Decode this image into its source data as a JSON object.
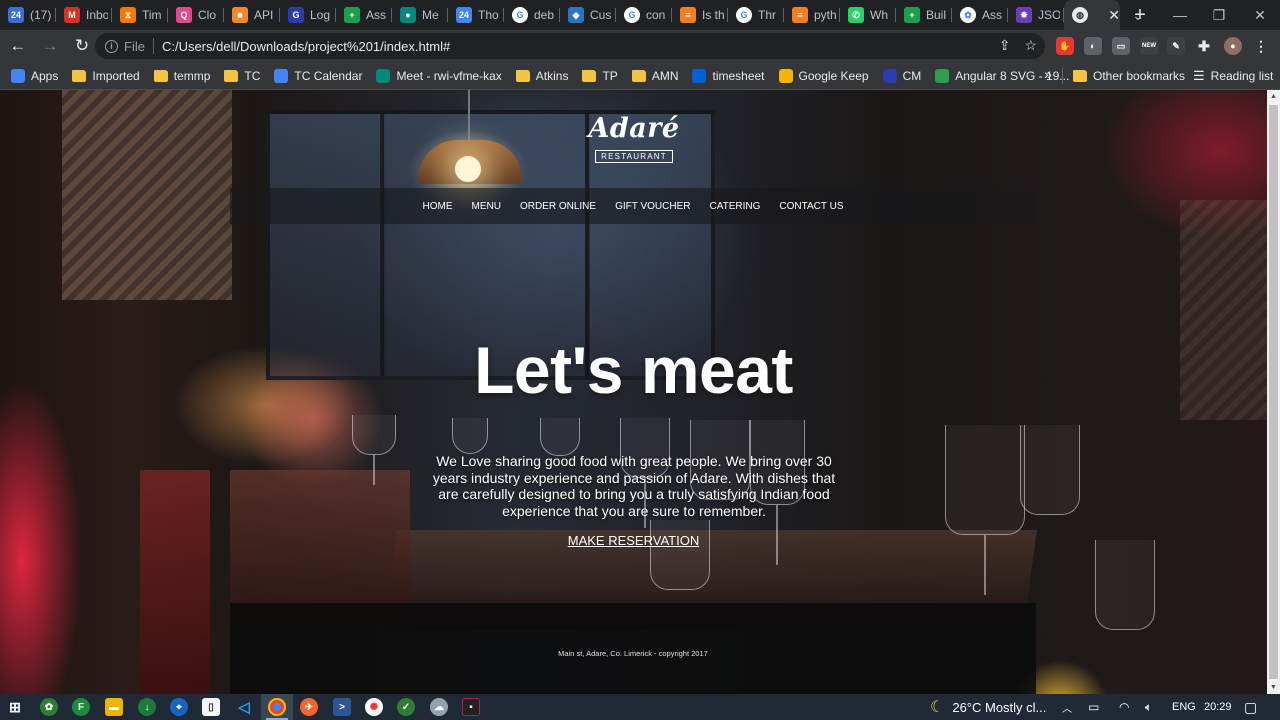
{
  "browser": {
    "tabs": [
      {
        "label": "(17)",
        "icon": "badge-24-icon",
        "color": "#3b6fd6",
        "glyph": "24"
      },
      {
        "label": "Inbox",
        "icon": "gmail-icon",
        "color": "#d93025",
        "glyph": "M"
      },
      {
        "label": "Tim",
        "icon": "timer-icon",
        "color": "#f57c00",
        "glyph": "⧖"
      },
      {
        "label": "Clo",
        "icon": "clockify-icon",
        "color": "#e24a8d",
        "glyph": "Q"
      },
      {
        "label": "API",
        "icon": "box-icon",
        "color": "#f2892c",
        "glyph": "■"
      },
      {
        "label": "Log",
        "icon": "cm-icon",
        "color": "#2a3cb0",
        "glyph": "G"
      },
      {
        "label": "Ass",
        "icon": "plus-sheet-icon",
        "color": "#1e9e4a",
        "glyph": "+"
      },
      {
        "label": "Me",
        "icon": "meet-icon",
        "color": "#00897b",
        "glyph": "●"
      },
      {
        "label": "Tho",
        "icon": "calendar-icon",
        "color": "#4285f4",
        "glyph": "24"
      },
      {
        "label": "deb",
        "icon": "google-icon",
        "color": "#ffffff",
        "glyph": "G"
      },
      {
        "label": "Cus",
        "icon": "azure-icon",
        "color": "#2d74c4",
        "glyph": "◆"
      },
      {
        "label": "con",
        "icon": "google-icon",
        "color": "#ffffff",
        "glyph": "G"
      },
      {
        "label": "Is th",
        "icon": "stackoverflow-icon",
        "color": "#f48024",
        "glyph": "≡"
      },
      {
        "label": "Thr",
        "icon": "google-icon",
        "color": "#ffffff",
        "glyph": "G"
      },
      {
        "label": "pyth",
        "icon": "stackoverflow-icon",
        "color": "#f48024",
        "glyph": "≡"
      },
      {
        "label": "Wh",
        "icon": "whatsapp-icon",
        "color": "#25d366",
        "glyph": "✆"
      },
      {
        "label": "Buil",
        "icon": "plus-sheet-icon",
        "color": "#1e9e4a",
        "glyph": "+"
      },
      {
        "label": "Ass",
        "icon": "openai-icon",
        "color": "#ffffff",
        "glyph": "✿"
      },
      {
        "label": "JSO",
        "icon": "json-icon",
        "color": "#6a3fb5",
        "glyph": "✸"
      }
    ],
    "active_tab_icon": "globe-icon",
    "new_tab_label": "+",
    "window_controls": {
      "chevron": "⌄",
      "minimize": "—",
      "maximize": "❐",
      "close": "✕"
    },
    "address": {
      "scheme_label": "File",
      "url": "C:/Users/dell/Downloads/project%201/index.html#"
    },
    "bookmarks": [
      {
        "label": "Apps",
        "icon": "apps-grid-icon",
        "color": "#4285f4"
      },
      {
        "label": "Imported",
        "icon": "folder-icon",
        "color": "#f4c542"
      },
      {
        "label": "temmp",
        "icon": "folder-icon",
        "color": "#f4c542"
      },
      {
        "label": "TC",
        "icon": "folder-icon",
        "color": "#f4c542"
      },
      {
        "label": "TC Calendar",
        "icon": "calendar-icon",
        "color": "#4285f4"
      },
      {
        "label": "Meet - rwi-vfme-kax",
        "icon": "meet-icon",
        "color": "#00897b"
      },
      {
        "label": "Atkins",
        "icon": "folder-icon",
        "color": "#f4c542"
      },
      {
        "label": "TP",
        "icon": "folder-icon",
        "color": "#f4c542"
      },
      {
        "label": "AMN",
        "icon": "folder-icon",
        "color": "#f4c542"
      },
      {
        "label": "timesheet",
        "icon": "box-icon",
        "color": "#0061d5"
      },
      {
        "label": "Google Keep",
        "icon": "keep-icon",
        "color": "#f6b400"
      },
      {
        "label": "CM",
        "icon": "cm-icon",
        "color": "#2a3cb0"
      },
      {
        "label": "Angular 8 SVG - 19...",
        "icon": "arrow-icon",
        "color": "#2e9d4e"
      }
    ],
    "bookmarks_more": "»",
    "other_bookmarks": "Other bookmarks",
    "reading_list": "Reading list"
  },
  "site": {
    "logo": {
      "name": "Adaré",
      "sub": "RESTAURANT"
    },
    "nav": [
      "HOME",
      "MENU",
      "ORDER ONLINE",
      "GIFT VOUCHER",
      "CATERING",
      "CONTACT US"
    ],
    "headline": "Let's meat",
    "intro": "We Love sharing good food with great people. We bring over 30 years industry experience and passion of Adare. With dishes that are carefully designed to bring you a truly satisfying Indian food experience that you are sure to remember.",
    "cta": "MAKE RESERVATION",
    "footer": "Main st, Adare, Co. Limerick - copyright 2017"
  },
  "taskbar": {
    "weather": "26°C  Mostly cl...",
    "language": "ENG",
    "time": "20:29"
  }
}
